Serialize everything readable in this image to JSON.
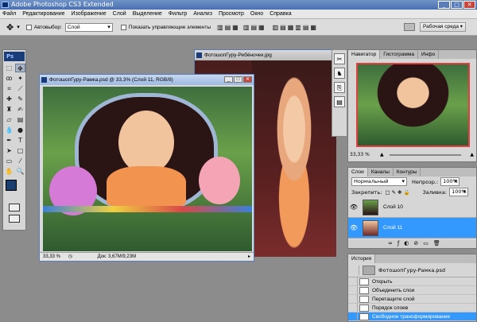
{
  "app": {
    "title": "Adobe Photoshop CS3 Extended"
  },
  "window_buttons": [
    "_",
    "□",
    "✕"
  ],
  "menu": [
    "Файл",
    "Редактирование",
    "Изображение",
    "Слой",
    "Выделение",
    "Фильтр",
    "Анализ",
    "Просмотр",
    "Окно",
    "Справка"
  ],
  "options": {
    "autoselect_label": "Автовыбор:",
    "autoselect_value": "Слой",
    "show_controls_label": "Показать управляющие элементы",
    "workspace_label": "Рабочая среда ▾"
  },
  "toolbox": {
    "logo": "Ps"
  },
  "doc_front": {
    "title": "ФотошопГуру-Рамка.psd @ 33,3% (Слой 11, RGB/8)",
    "zoom": "33,33 %",
    "doc_size": "Док: 3,67M/9,23M"
  },
  "doc_back": {
    "title": "ФотошопГуру-Ребёночек.jpg"
  },
  "navigator": {
    "tabs": [
      "Навигатор",
      "Гистограмма",
      "Инфо"
    ],
    "zoom": "33,33 %"
  },
  "layers": {
    "tabs": [
      "Слои",
      "Каналы",
      "Контуры"
    ],
    "blend_mode": "Нормальный",
    "opacity_label": "Непрозр.:",
    "opacity_value": "100%",
    "lock_label": "Закрепить:",
    "fill_label": "Заливка:",
    "fill_value": "100%",
    "items": [
      {
        "name": "Слой 10",
        "selected": false
      },
      {
        "name": "Слой 11",
        "selected": true
      }
    ]
  },
  "history": {
    "tab": "История",
    "snapshot": "ФотошопГуру-Рамка.psd",
    "items": [
      "Открыть",
      "Объединить слои",
      "Перетащите слой",
      "Порядок слоев",
      "Свободное трансформирование"
    ]
  },
  "colors": {
    "accent": "#3399ff",
    "title_blue": "#4a6fb0"
  }
}
